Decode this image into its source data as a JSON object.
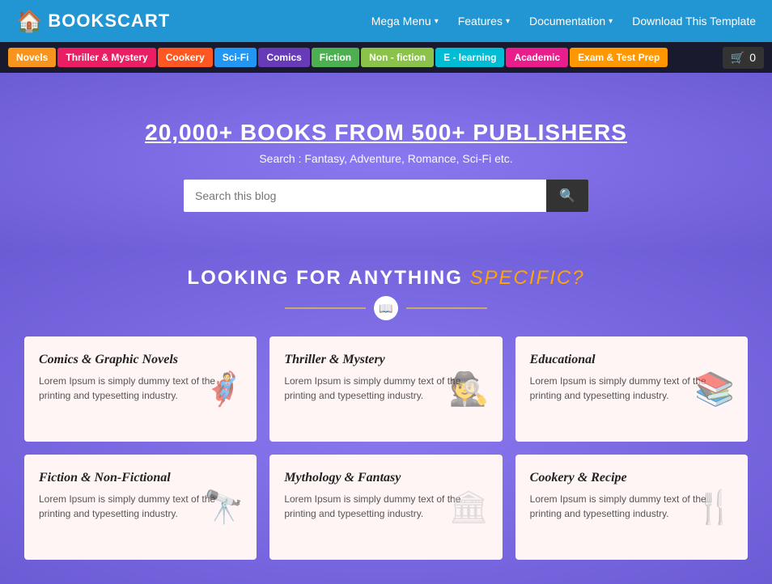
{
  "header": {
    "logo_text": "BOOKSCART",
    "nav_items": [
      {
        "label": "Mega Menu",
        "has_arrow": true
      },
      {
        "label": "Features",
        "has_arrow": true
      },
      {
        "label": "Documentation",
        "has_arrow": true
      },
      {
        "label": "Download This Template",
        "has_arrow": false
      }
    ],
    "cart_count": "0"
  },
  "categories_bar": [
    {
      "label": "Novels",
      "color": "#f7941d"
    },
    {
      "label": "Thriller & Mystery",
      "color": "#e91e63"
    },
    {
      "label": "Cookery",
      "color": "#ff5722"
    },
    {
      "label": "Sci-Fi",
      "color": "#2196f3"
    },
    {
      "label": "Comics",
      "color": "#673ab7"
    },
    {
      "label": "Fiction",
      "color": "#4caf50"
    },
    {
      "label": "Non - fiction",
      "color": "#8bc34a"
    },
    {
      "label": "E - learning",
      "color": "#00bcd4"
    },
    {
      "label": "Academic",
      "color": "#e91e8c"
    },
    {
      "label": "Exam & Test Prep",
      "color": "#ff9800"
    }
  ],
  "hero": {
    "title_line1": "20,000+ BOOKS FROM 500+ PUBLISHERS",
    "subtitle": "Search : Fantasy, Adventure, Romance, Sci-Fi etc.",
    "search_placeholder": "Search this blog"
  },
  "section": {
    "title_main": "LOOKING FOR ANYTHING",
    "title_accent": "Specific?",
    "divider_icon": "📖"
  },
  "cards": [
    {
      "title": "Comics & Graphic Novels",
      "text": "Lorem Ipsum is simply dummy text of the printing and typesetting industry.",
      "icon": "🦸"
    },
    {
      "title": "Thriller & Mystery",
      "text": "Lorem Ipsum is simply dummy text of the printing and typesetting industry.",
      "icon": "🕵"
    },
    {
      "title": "Educational",
      "text": "Lorem Ipsum is simply dummy text of the printing and typesetting industry.",
      "icon": "📚"
    },
    {
      "title": "Fiction & Non-Fictional",
      "text": "Lorem Ipsum is simply dummy text of the printing and typesetting industry.",
      "icon": "🔭"
    },
    {
      "title": "Mythology & Fantasy",
      "text": "Lorem Ipsum is simply dummy text of the printing and typesetting industry.",
      "icon": "🏛"
    },
    {
      "title": "Cookery & Recipe",
      "text": "Lorem Ipsum is simply dummy text of the printing and typesetting industry.",
      "icon": "🍴"
    }
  ]
}
